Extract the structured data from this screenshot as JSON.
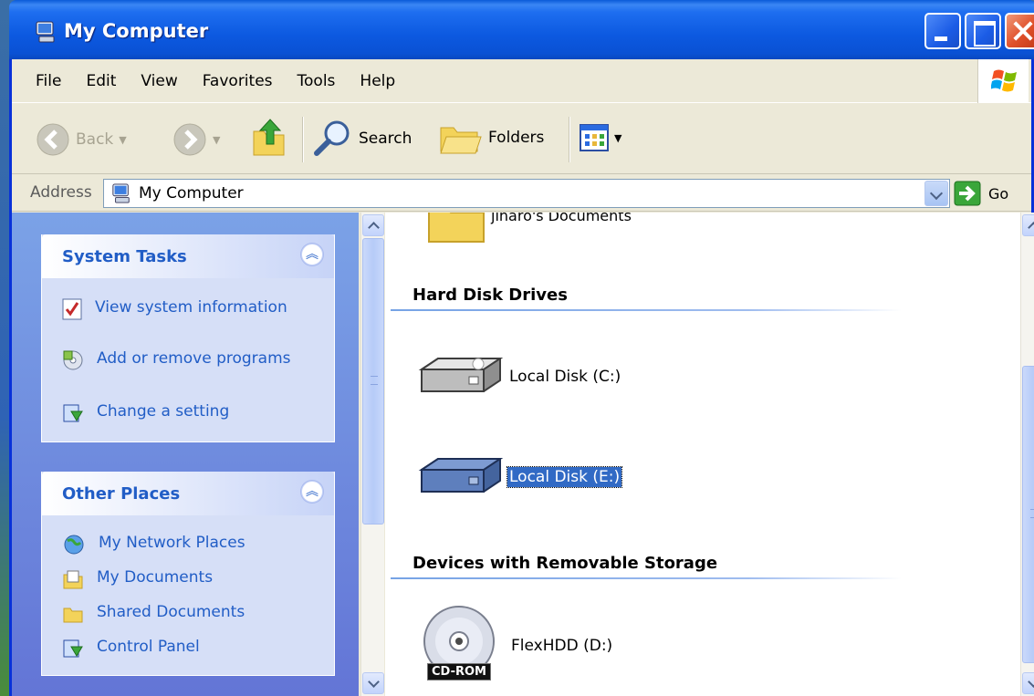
{
  "window": {
    "title": "My Computer"
  },
  "menu": [
    "File",
    "Edit",
    "View",
    "Favorites",
    "Tools",
    "Help"
  ],
  "toolbar": {
    "back_label": "Back",
    "search_label": "Search",
    "folders_label": "Folders"
  },
  "address": {
    "label": "Address",
    "value": "My Computer",
    "go_label": "Go"
  },
  "system_tasks": {
    "title": "System Tasks",
    "items": [
      "View system information",
      "Add or remove programs",
      "Change a setting"
    ]
  },
  "other_places": {
    "title": "Other Places",
    "items": [
      "My Network Places",
      "My Documents",
      "Shared Documents",
      "Control Panel"
    ]
  },
  "content": {
    "partial_folder_label": "jiharo's Documents",
    "groups": [
      {
        "title": "Hard Disk Drives",
        "items": [
          {
            "label": "Local Disk (C:)",
            "selected": false
          },
          {
            "label": "Local Disk (E:)",
            "selected": true
          }
        ]
      },
      {
        "title": "Devices with Removable Storage",
        "items": [
          {
            "label": "FlexHDD (D:)",
            "badge": "CD-ROM"
          }
        ]
      }
    ]
  },
  "colors": {
    "titlebar": "#0a51d4",
    "taskpane": "#6f8edd",
    "link": "#215dc6",
    "selection": "#316ac5"
  }
}
